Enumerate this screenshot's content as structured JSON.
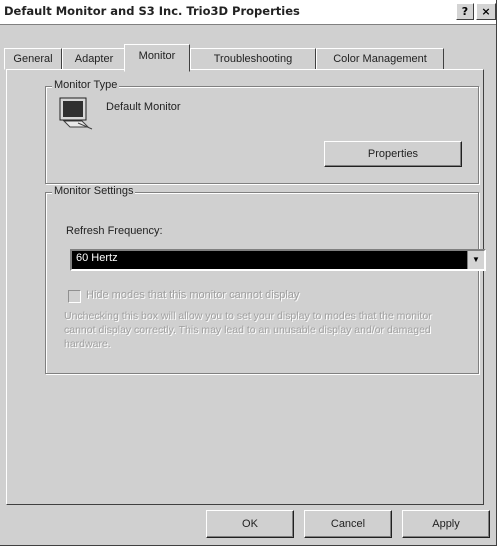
{
  "window": {
    "title": "Default Monitor and S3 Inc. Trio3D Properties",
    "help_label": "?",
    "close_label": "×"
  },
  "tabs": [
    {
      "label": "General",
      "active": false
    },
    {
      "label": "Adapter",
      "active": false
    },
    {
      "label": "Monitor",
      "active": true
    },
    {
      "label": "Troubleshooting",
      "active": false
    },
    {
      "label": "Color Management",
      "active": false
    }
  ],
  "monitor_type": {
    "legend": "Monitor Type",
    "monitor_name": "Default Monitor",
    "properties_label": "Properties",
    "icon": "monitor-icon"
  },
  "monitor_settings": {
    "legend": "Monitor Settings",
    "refresh_label": "Refresh Frequency:",
    "refresh_value": "60 Hertz",
    "hide_modes_label": "Hide modes that this monitor cannot display",
    "hide_modes_checked": false,
    "warning_text": "Unchecking this box will allow you to set your display to modes that the monitor cannot display correctly. This may lead to an unusable display and/or damaged hardware."
  },
  "buttons": {
    "ok": "OK",
    "cancel": "Cancel",
    "apply": "Apply"
  }
}
